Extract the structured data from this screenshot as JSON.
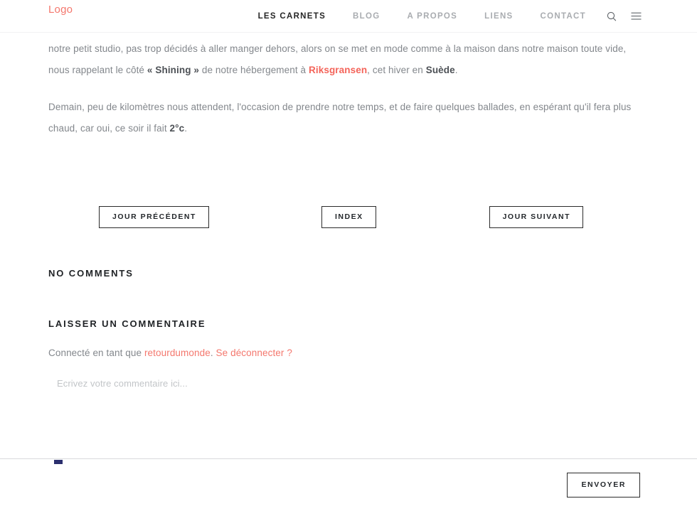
{
  "header": {
    "logo": "Logo",
    "nav_items": [
      {
        "label": "LES CARNETS",
        "active": true
      },
      {
        "label": "BLOG",
        "active": false
      },
      {
        "label": "A PROPOS",
        "active": false
      },
      {
        "label": "LIENS",
        "active": false
      },
      {
        "label": "CONTACT",
        "active": false
      }
    ],
    "icons": {
      "search": "search-icon",
      "menu": "hamburger-menu-icon"
    }
  },
  "article": {
    "paragraph1": {
      "part1": "notre petit studio, pas trop décidés à aller manger dehors, alors on se met en mode comme à la maison dans notre maison toute vide, nous rappelant le côté ",
      "bold1": "« Shining »",
      "part2": " de notre hébergement à ",
      "link1": "Riksgransen",
      "part3": ", cet hiver en ",
      "bold2": "Suède",
      "part4": "."
    },
    "paragraph2": {
      "part1": "Demain, peu de kilomètres nous attendent, l'occasion de prendre notre temps, et de faire quelques ballades, en espérant qu'il fera plus chaud, car oui, ce soir il fait ",
      "bold1": "2°c",
      "part2": "."
    }
  },
  "post_nav": {
    "previous": "JOUR PRÉCÉDENT",
    "index": "INDEX",
    "next": "JOUR SUIVANT"
  },
  "comments": {
    "no_comments_title": "NO COMMENTS",
    "leave_comment_title": "LAISSER UN COMMENTAIRE",
    "logged_in_prefix": "Connecté en tant que ",
    "username": "retourdumonde",
    "logged_in_separator": ". ",
    "logout_label": "Se déconnecter ?",
    "comment_placeholder": "Ecrivez votre commentaire ici...",
    "comment_value": "",
    "submit_label": "ENVOYER"
  },
  "colors": {
    "accent": "#f4776d",
    "link": "#f4645a",
    "text": "#83878c",
    "heading": "#1f2225",
    "border": "#2b2b2b"
  }
}
